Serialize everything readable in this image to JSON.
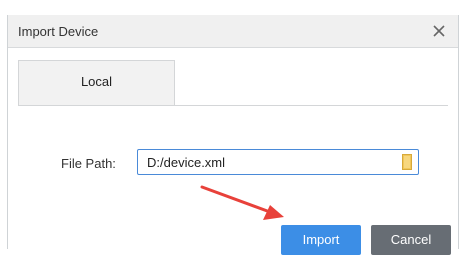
{
  "dialog": {
    "title": "Import Device",
    "close_icon": "close-icon"
  },
  "tabs": [
    {
      "label": "Local"
    }
  ],
  "form": {
    "file_path_label": "File Path:",
    "file_path_value": "D:/device.xml",
    "browse_icon": "folder-icon"
  },
  "buttons": {
    "import_label": "Import",
    "cancel_label": "Cancel"
  },
  "annotation": {
    "arrow_color": "#e8413a"
  },
  "colors": {
    "primary": "#3c8ee6",
    "secondary": "#676d74",
    "focus_border": "#4a8ad8"
  }
}
